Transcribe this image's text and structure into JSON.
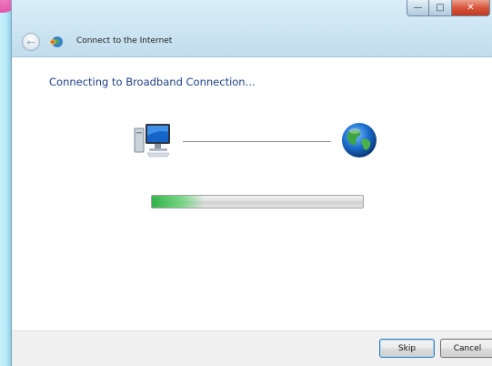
{
  "window": {
    "title": "Connect to the Internet",
    "caption_buttons": {
      "minimize_icon": "minimize-icon",
      "maximize_icon": "maximize-icon",
      "close_icon": "close-icon"
    }
  },
  "content": {
    "heading": "Connecting to Broadband Connection...",
    "progress": 0.25,
    "progress_color": "#2fbf45"
  },
  "footer": {
    "skip_label": "Skip",
    "cancel_label": "Cancel"
  },
  "icons": {
    "back": "back-arrow-icon",
    "wizard": "network-globe-icon",
    "computer": "computer-icon",
    "internet": "globe-icon"
  }
}
